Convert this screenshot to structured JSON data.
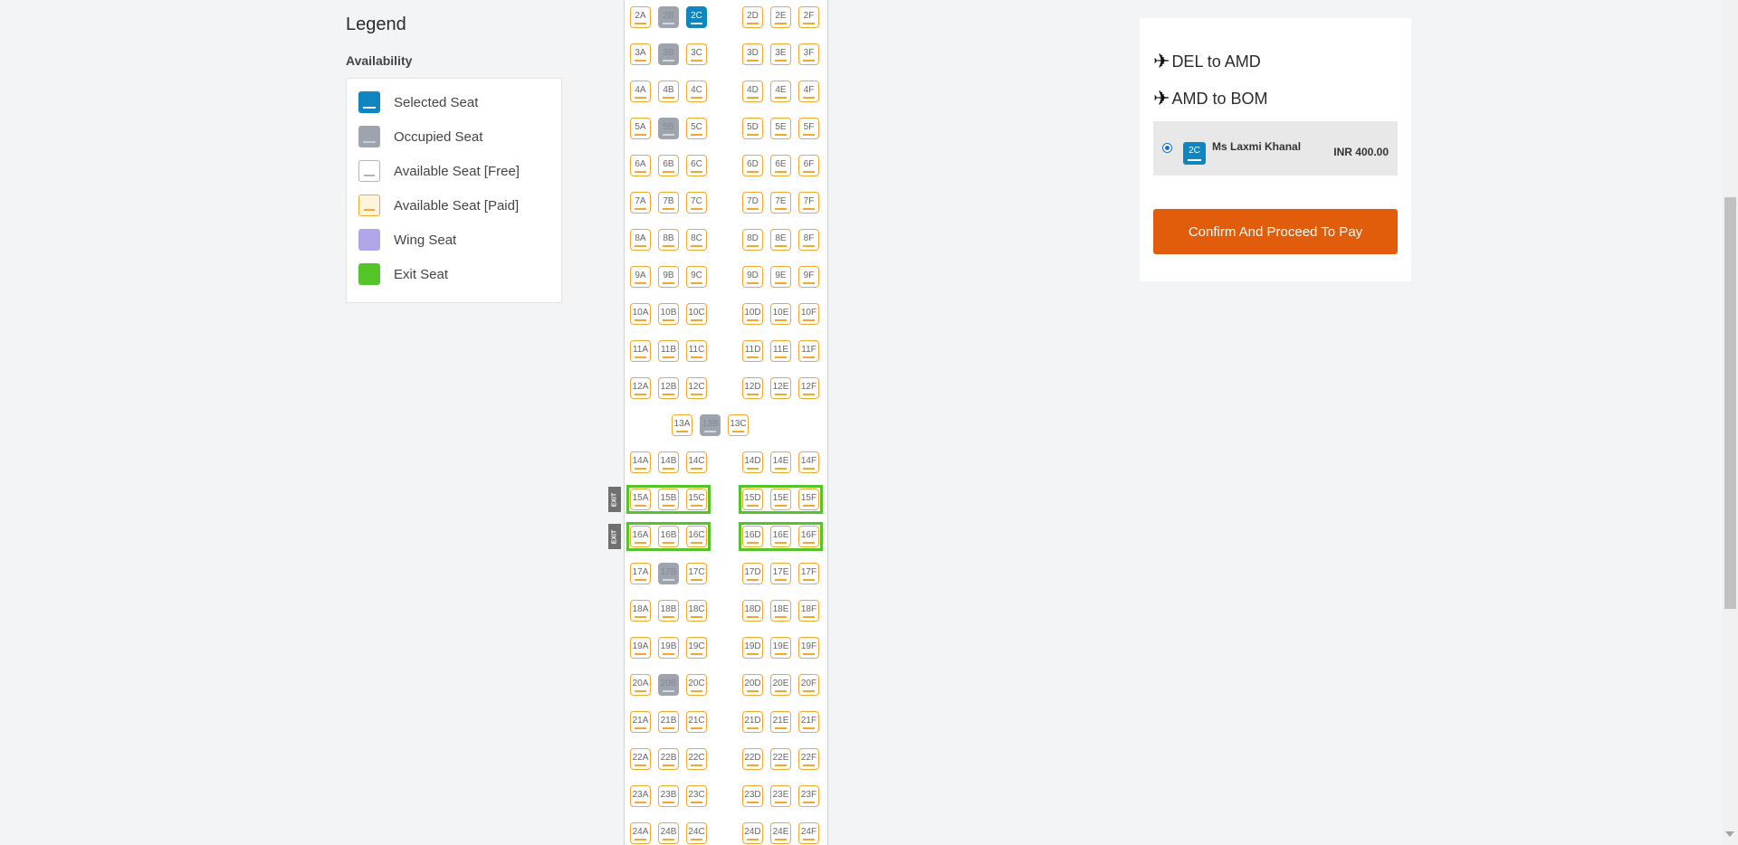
{
  "legend": {
    "title": "Legend",
    "subtitle": "Availability",
    "items": [
      {
        "label": "Selected Seat",
        "type": "selected",
        "color": "#0f86bf"
      },
      {
        "label": "Occupied Seat",
        "type": "occupied",
        "color": "#9ea4ad"
      },
      {
        "label": "Available Seat [Free]",
        "type": "free",
        "color": "#ffffff"
      },
      {
        "label": "Available Seat [Paid]",
        "type": "paid",
        "color": "#fff4dc"
      },
      {
        "label": "Wing Seat",
        "type": "wing",
        "color": "#b3a6e8"
      },
      {
        "label": "Exit Seat",
        "type": "exit",
        "color": "#54c42b"
      }
    ]
  },
  "seatmap": {
    "rows": [
      2,
      3,
      4,
      5,
      6,
      7,
      8,
      9,
      10,
      11,
      12,
      13,
      14,
      15,
      16,
      17,
      18,
      19,
      20,
      21,
      22,
      23,
      24
    ],
    "columns": [
      "A",
      "B",
      "C",
      "D",
      "E",
      "F"
    ],
    "occupied": [
      "2B",
      "3B",
      "5B",
      "13B",
      "17B",
      "20B"
    ],
    "selected": [
      "2C"
    ],
    "exit_rows": [
      15,
      16
    ],
    "exit_label": "EXIT",
    "row_13_columns": [
      "A",
      "B",
      "C"
    ]
  },
  "booking": {
    "routes": [
      {
        "icon": "plane-icon",
        "text": "DEL to AMD"
      },
      {
        "icon": "plane-icon",
        "text": "AMD to BOM"
      }
    ],
    "passenger": {
      "seat": "2C",
      "name": "Ms Laxmi Khanal",
      "price": "INR 400.00"
    },
    "pay_button": "Confirm And Proceed To Pay"
  }
}
